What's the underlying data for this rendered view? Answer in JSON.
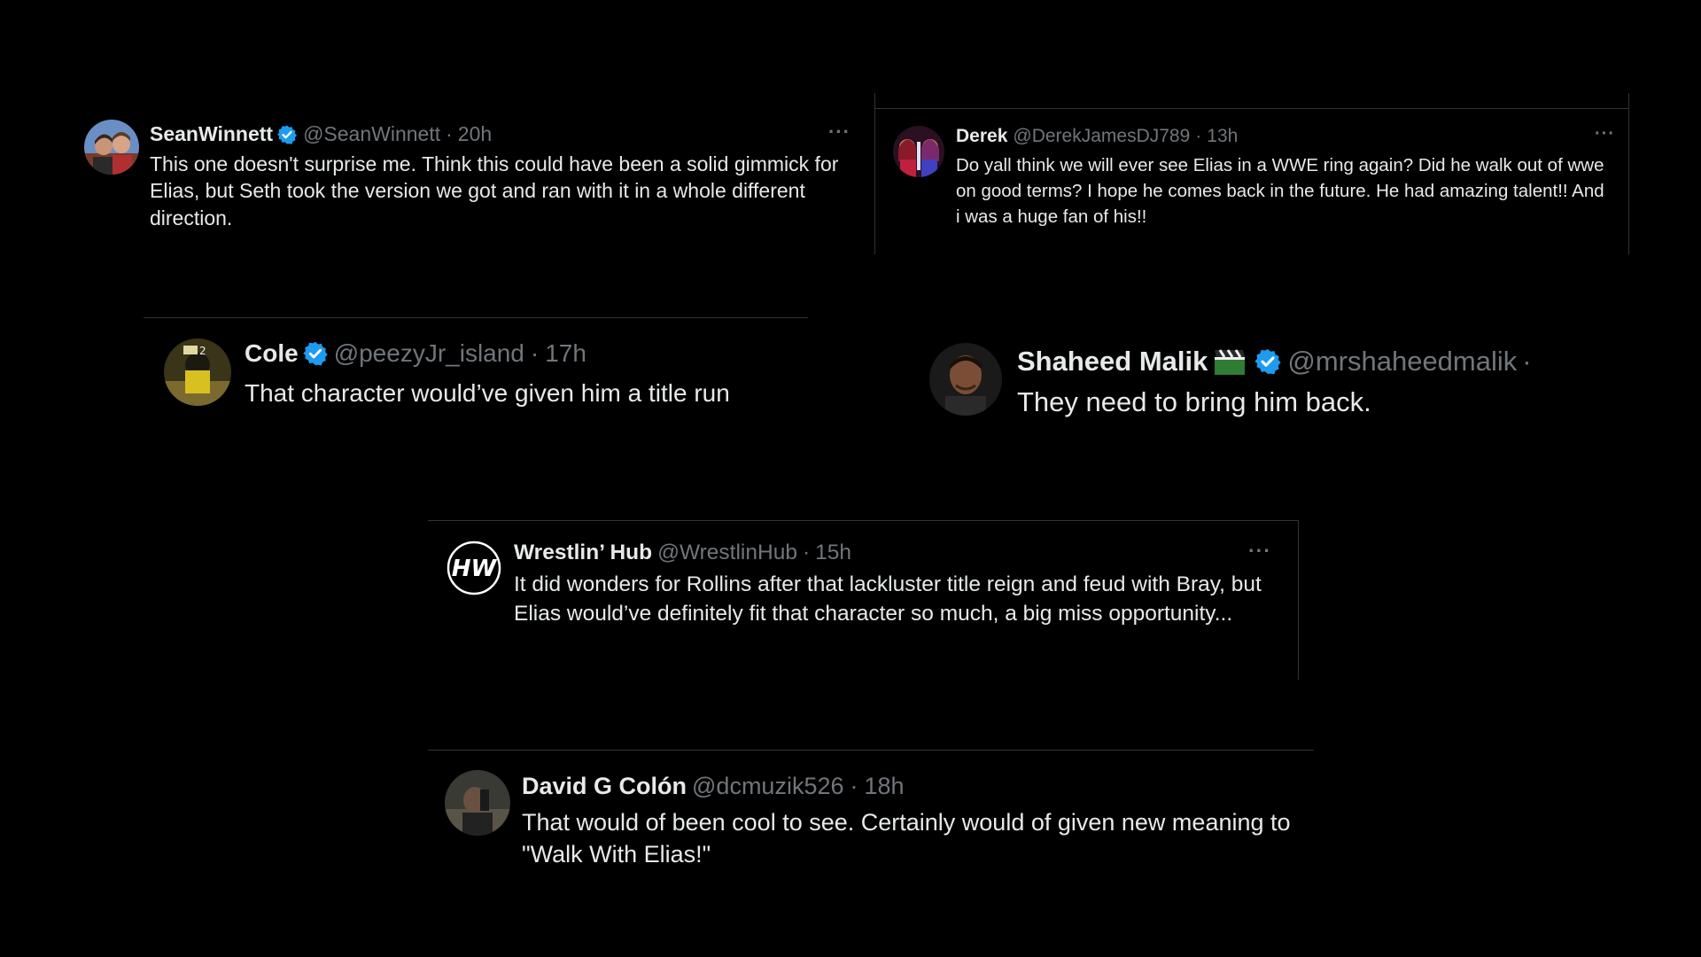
{
  "colors": {
    "background": "#000000",
    "text": "#e7e9ea",
    "muted": "#71767b",
    "verified": "#1d9bf0",
    "divider": "#2f3336"
  },
  "tweets": [
    {
      "name": "SeanWinnett",
      "handle": "@SeanWinnett",
      "sep": "·",
      "time": "20h",
      "verified": true,
      "more": "···",
      "text": "This one doesn't surprise me. Think this could have been a solid gimmick for Elias, but Seth took the version we got and ran with it in a whole different direction."
    },
    {
      "name": "Derek",
      "handle": "@DerekJamesDJ789",
      "sep": "·",
      "time": "13h",
      "verified": false,
      "more": "···",
      "text": "Do yall think we will ever see Elias in a WWE ring again? Did he walk out of wwe on good terms? I hope he comes back in the future. He had amazing talent!! And i was a huge fan of his!!"
    },
    {
      "name": "Cole",
      "handle": "@peezyJr_island",
      "sep": "·",
      "time": "17h",
      "verified": true,
      "text": "That character would’ve given him a title run"
    },
    {
      "name": "Shaheed Malik",
      "emoji": "clapper-board-icon",
      "handle": "@mrshaheedmalik",
      "sep": "·",
      "verified": true,
      "text": "They need to bring him back."
    },
    {
      "name": "Wrestlin’ Hub",
      "handle": "@WrestlinHub",
      "sep": "·",
      "time": "15h",
      "verified": false,
      "more": "···",
      "avatar_text": "HW",
      "text": "It did wonders for Rollins after that lackluster title reign and feud with Bray, but Elias would’ve definitely fit that character so much, a big miss opportunity..."
    },
    {
      "name": "David G Colón",
      "handle": "@dcmuzik526",
      "sep": "·",
      "time": "18h",
      "verified": false,
      "text": "That would of been cool to see. Certainly would of given new meaning to \"Walk With Elias!\""
    }
  ]
}
